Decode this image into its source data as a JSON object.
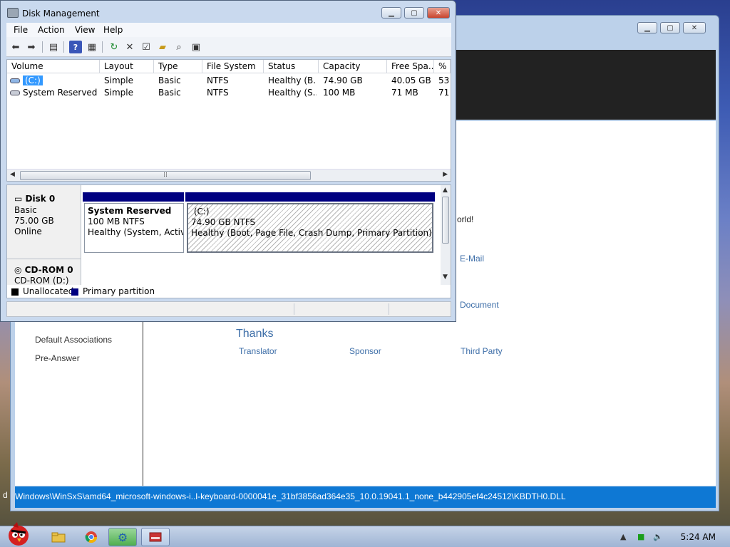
{
  "colors": {
    "statusbar": "#0e78d4",
    "selection": "#3399ff",
    "primary_partition": "#000080",
    "link": "#3d6ea8"
  },
  "background_app": {
    "sidebar": [
      "Default Associations",
      "Pre-Answer"
    ],
    "partial_text": "orld!",
    "links": {
      "email": "E-Mail",
      "document": "Document",
      "translator": "Translator",
      "sponsor": "Sponsor",
      "third_party": "Third Party"
    },
    "thanks": "Thanks",
    "status_path": "Windows\\WinSxS\\amd64_microsoft-windows-i..l-keyboard-0000041e_31bf3856ad364e35_10.0.19041.1_none_b442905ef4c24512\\KBDTH0.DLL",
    "status_prefix": "d"
  },
  "disk_management": {
    "title": "Disk Management",
    "menu": [
      "File",
      "Action",
      "View",
      "Help"
    ],
    "columns": [
      "Volume",
      "Layout",
      "Type",
      "File System",
      "Status",
      "Capacity",
      "Free Spa...",
      "% F"
    ],
    "volumes": [
      {
        "volume": "(C:)",
        "layout": "Simple",
        "type": "Basic",
        "fs": "NTFS",
        "status": "Healthy (B...",
        "capacity": "74.90 GB",
        "free": "40.05 GB",
        "pct": "53"
      },
      {
        "volume": "System Reserved",
        "layout": "Simple",
        "type": "Basic",
        "fs": "NTFS",
        "status": "Healthy (S...",
        "capacity": "100 MB",
        "free": "71 MB",
        "pct": "71"
      }
    ],
    "disk0": {
      "name": "Disk 0",
      "type": "Basic",
      "size": "75.00 GB",
      "state": "Online"
    },
    "partitions": [
      {
        "name": "System Reserved",
        "size": "100 MB NTFS",
        "status": "Healthy (System, Active,"
      },
      {
        "name": "(C:)",
        "size": "74.90 GB NTFS",
        "status": "Healthy (Boot, Page File, Crash Dump, Primary Partition)"
      }
    ],
    "cdrom": {
      "name": "CD-ROM 0",
      "drive": "CD-ROM (D:)"
    },
    "legend": {
      "unallocated": "Unallocated",
      "primary": "Primary partition"
    }
  },
  "taskbar": {
    "clock": "5:24 AM"
  },
  "icons": [
    "back-icon",
    "forward-icon",
    "properties-icon",
    "help-icon",
    "refresh-icon",
    "delete-icon",
    "open-icon",
    "search-icon",
    "angry-bird-icon",
    "explorer-icon",
    "chrome-icon"
  ]
}
